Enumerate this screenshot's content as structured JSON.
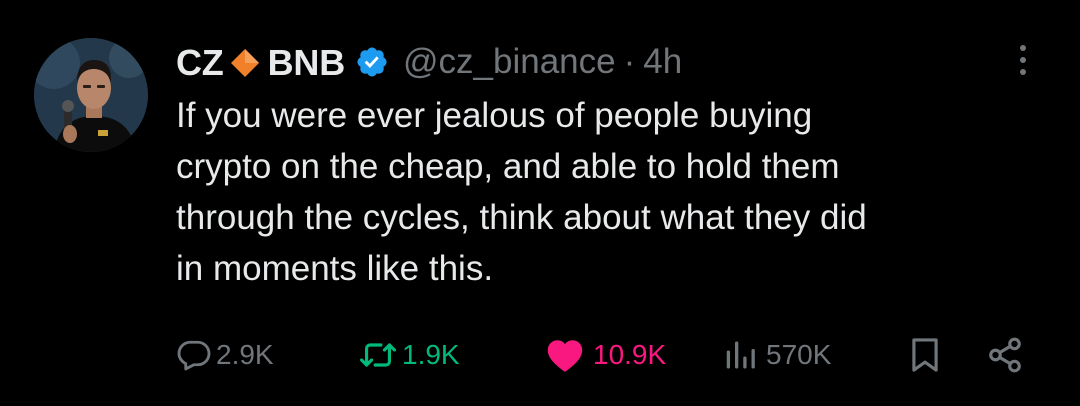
{
  "author": {
    "name_first": "CZ",
    "name_second": "BNB",
    "handle": "@cz_binance",
    "separator": "·",
    "time": "4h"
  },
  "tweet": {
    "lines": [
      "If you were ever jealous of people buying",
      "crypto on the cheap, and able to hold them",
      "through the cycles, think about what they did",
      "in moments like this."
    ]
  },
  "actions": {
    "replies": "2.9K",
    "reposts": "1.9K",
    "likes": "10.9K",
    "views": "570K"
  },
  "icons": {
    "reply": "reply-icon",
    "repost": "repost-icon",
    "like": "heart-icon",
    "views": "views-icon",
    "bookmark": "bookmark-icon",
    "share": "share-icon",
    "more": "more-icon",
    "verified": "verified-badge-icon",
    "diamond": "orange-diamond-icon"
  },
  "colors": {
    "background": "#000000",
    "text": "#e7e9ea",
    "secondary": "#71767b",
    "verified": "#1d9bf0",
    "repost_green": "#00ba7c",
    "like_pink": "#f91880",
    "diamond_orange": "#f0802a"
  }
}
